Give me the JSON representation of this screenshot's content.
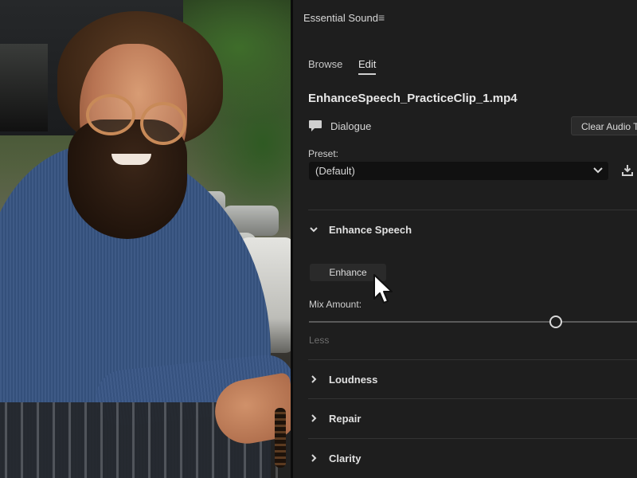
{
  "panel": {
    "title": "Essential Sound",
    "menu_icon": "hamburger-menu-icon",
    "tabs": [
      {
        "label": "Browse",
        "active": false
      },
      {
        "label": "Edit",
        "active": true
      }
    ],
    "clip_name": "EnhanceSpeech_PracticeClip_1.mp4",
    "clip_type": {
      "icon": "speech-bubble-icon",
      "label": "Dialogue"
    },
    "clear_button": "Clear Audio T",
    "preset": {
      "label": "Preset:",
      "value": "(Default)"
    },
    "sections": [
      {
        "label": "Enhance Speech",
        "expanded": true
      },
      {
        "label": "Loudness",
        "expanded": false
      },
      {
        "label": "Repair",
        "expanded": false
      },
      {
        "label": "Clarity",
        "expanded": false
      }
    ],
    "enhance_button": "Enhance",
    "mix_amount": {
      "label": "Mix Amount:",
      "min_label": "Less"
    }
  },
  "colors": {
    "panel_bg": "#1e1e1e",
    "text": "#d6d6d6",
    "dropdown_bg": "#111111",
    "button_bg": "#2a2a2a"
  }
}
